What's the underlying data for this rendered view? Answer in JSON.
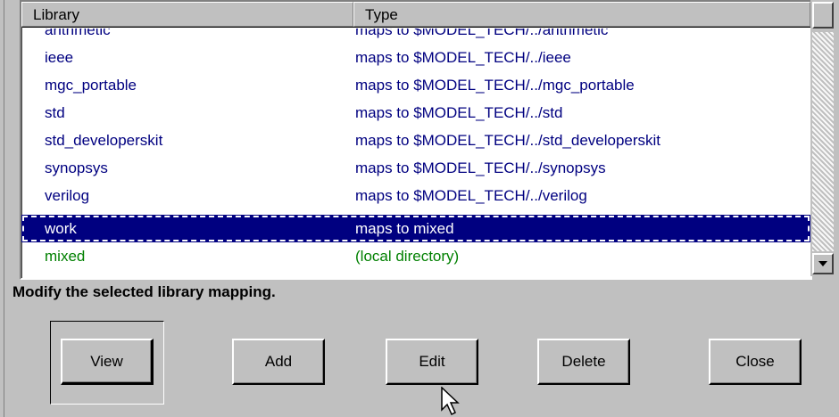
{
  "columns": {
    "library": "Library",
    "type": "Type"
  },
  "rows": [
    {
      "library": "arithmetic",
      "type": "maps to $MODEL_TECH/../arithmetic"
    },
    {
      "library": "ieee",
      "type": "maps to $MODEL_TECH/../ieee"
    },
    {
      "library": "mgc_portable",
      "type": "maps to $MODEL_TECH/../mgc_portable"
    },
    {
      "library": "std",
      "type": "maps to $MODEL_TECH/../std"
    },
    {
      "library": "std_developerskit",
      "type": "maps to $MODEL_TECH/../std_developerskit"
    },
    {
      "library": "synopsys",
      "type": "maps to $MODEL_TECH/../synopsys"
    },
    {
      "library": "verilog",
      "type": "maps to $MODEL_TECH/../verilog"
    },
    {
      "library": "work",
      "type": "maps to mixed"
    },
    {
      "library": "mixed",
      "type": "(local directory)"
    }
  ],
  "status": "Modify the selected library mapping.",
  "buttons": {
    "view": "View",
    "add": "Add",
    "edit": "Edit",
    "delete": "Delete",
    "close": "Close"
  },
  "colors": {
    "selection": "#000080",
    "link_text": "#000080",
    "local_text": "#008000",
    "face": "#c0c0c0"
  },
  "icons": {
    "cursor": "arrow-pointer-icon",
    "scroll_down": "chevron-down-icon"
  }
}
